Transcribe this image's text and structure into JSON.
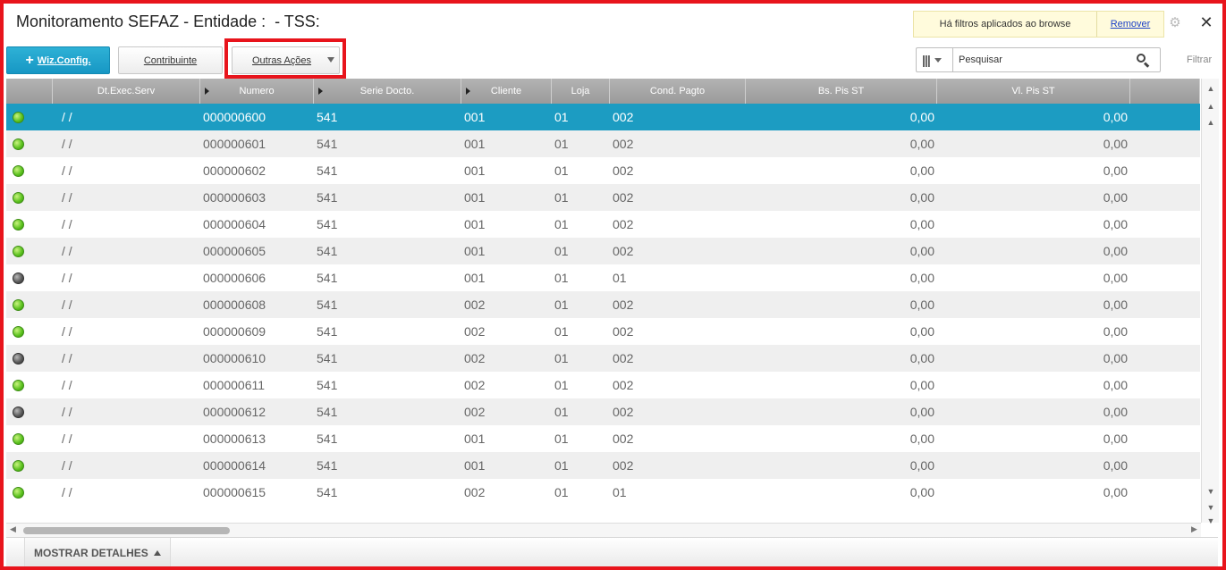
{
  "window": {
    "title": "Monitoramento SEFAZ - Entidade :  - TSS:"
  },
  "filter_notice": {
    "text": "Há filtros aplicados ao browse",
    "remove_label": "Remover"
  },
  "toolbar": {
    "wiz_config_label": "Wiz.Config.",
    "contribuinte_label": "Contribuinte",
    "outras_acoes_label": "Outras Ações"
  },
  "search": {
    "placeholder": "Pesquisar",
    "filter_label": "Filtrar"
  },
  "grid": {
    "columns": [
      {
        "label": "",
        "sortable": false
      },
      {
        "label": "Dt.Exec.Serv",
        "sortable": false
      },
      {
        "label": "Numero",
        "sortable": true
      },
      {
        "label": "Serie Docto.",
        "sortable": true
      },
      {
        "label": "Cliente",
        "sortable": true
      },
      {
        "label": "Loja",
        "sortable": false
      },
      {
        "label": "Cond. Pagto",
        "sortable": false
      },
      {
        "label": "Bs. Pis ST",
        "sortable": false
      },
      {
        "label": "Vl. Pis ST",
        "sortable": false
      },
      {
        "label": "",
        "sortable": false
      }
    ],
    "selected_index": 0,
    "rows": [
      {
        "status": "green",
        "dt": " /  /",
        "numero": "000000600",
        "serie": "541",
        "cliente": "001",
        "loja": "01",
        "cond": "002",
        "bs": "0,00",
        "vl": "0,00"
      },
      {
        "status": "green",
        "dt": " /  /",
        "numero": "000000601",
        "serie": "541",
        "cliente": "001",
        "loja": "01",
        "cond": "002",
        "bs": "0,00",
        "vl": "0,00"
      },
      {
        "status": "green",
        "dt": " /  /",
        "numero": "000000602",
        "serie": "541",
        "cliente": "001",
        "loja": "01",
        "cond": "002",
        "bs": "0,00",
        "vl": "0,00"
      },
      {
        "status": "green",
        "dt": " /  /",
        "numero": "000000603",
        "serie": "541",
        "cliente": "001",
        "loja": "01",
        "cond": "002",
        "bs": "0,00",
        "vl": "0,00"
      },
      {
        "status": "green",
        "dt": " /  /",
        "numero": "000000604",
        "serie": "541",
        "cliente": "001",
        "loja": "01",
        "cond": "002",
        "bs": "0,00",
        "vl": "0,00"
      },
      {
        "status": "green",
        "dt": " /  /",
        "numero": "000000605",
        "serie": "541",
        "cliente": "001",
        "loja": "01",
        "cond": "002",
        "bs": "0,00",
        "vl": "0,00"
      },
      {
        "status": "gray",
        "dt": " /  /",
        "numero": "000000606",
        "serie": "541",
        "cliente": "001",
        "loja": "01",
        "cond": "01",
        "bs": "0,00",
        "vl": "0,00"
      },
      {
        "status": "green",
        "dt": " /  /",
        "numero": "000000608",
        "serie": "541",
        "cliente": "002",
        "loja": "01",
        "cond": "002",
        "bs": "0,00",
        "vl": "0,00"
      },
      {
        "status": "green",
        "dt": " /  /",
        "numero": "000000609",
        "serie": "541",
        "cliente": "002",
        "loja": "01",
        "cond": "002",
        "bs": "0,00",
        "vl": "0,00"
      },
      {
        "status": "gray",
        "dt": " /  /",
        "numero": "000000610",
        "serie": "541",
        "cliente": "002",
        "loja": "01",
        "cond": "002",
        "bs": "0,00",
        "vl": "0,00"
      },
      {
        "status": "green",
        "dt": " /  /",
        "numero": "000000611",
        "serie": "541",
        "cliente": "002",
        "loja": "01",
        "cond": "002",
        "bs": "0,00",
        "vl": "0,00"
      },
      {
        "status": "gray",
        "dt": " /  /",
        "numero": "000000612",
        "serie": "541",
        "cliente": "002",
        "loja": "01",
        "cond": "002",
        "bs": "0,00",
        "vl": "0,00"
      },
      {
        "status": "green",
        "dt": " /  /",
        "numero": "000000613",
        "serie": "541",
        "cliente": "001",
        "loja": "01",
        "cond": "002",
        "bs": "0,00",
        "vl": "0,00"
      },
      {
        "status": "green",
        "dt": " /  /",
        "numero": "000000614",
        "serie": "541",
        "cliente": "001",
        "loja": "01",
        "cond": "002",
        "bs": "0,00",
        "vl": "0,00"
      },
      {
        "status": "green",
        "dt": " /  /",
        "numero": "000000615",
        "serie": "541",
        "cliente": "002",
        "loja": "01",
        "cond": "01",
        "bs": "0,00",
        "vl": "0,00"
      }
    ]
  },
  "footer": {
    "details_label": "MOSTRAR DETALHES"
  },
  "icons": {
    "close": "close-icon",
    "settings": "gear-icon",
    "search": "search-icon",
    "columns": "columns-icon",
    "status_green": "status-green-icon",
    "status_gray": "status-gray-icon"
  },
  "colors": {
    "accent": "#1c9cc2",
    "highlight_border": "#e8141c",
    "status_green": "#58c01c",
    "status_gray": "#555555"
  }
}
